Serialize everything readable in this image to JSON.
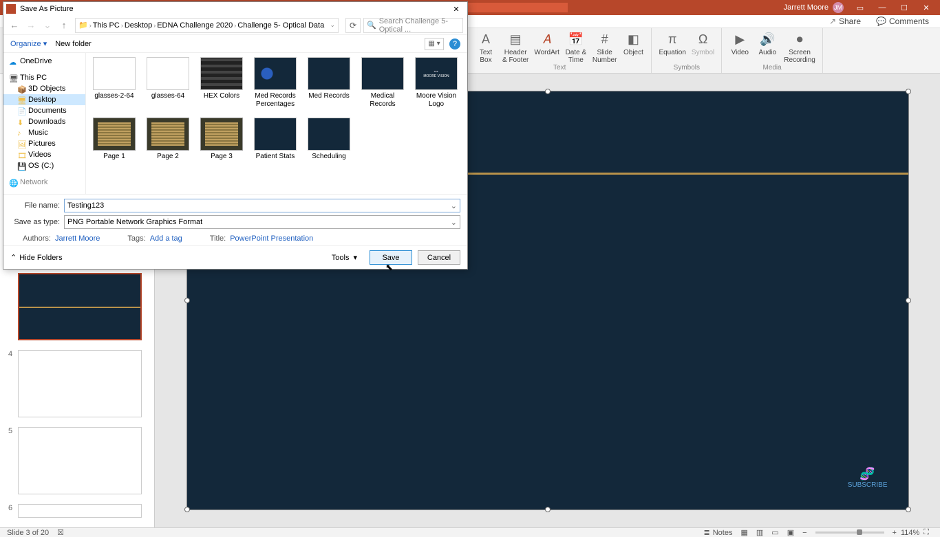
{
  "ppt": {
    "user": "Jarrett Moore",
    "initials": "JM",
    "share": "Share",
    "comments": "Comments",
    "ribbon": {
      "textGroup": "Text",
      "symbolsGroup": "Symbols",
      "mediaGroup": "Media",
      "textBox": "Text\nBox",
      "headerFooter": "Header\n& Footer",
      "wordArt": "WordArt",
      "dateTime": "Date &\nTime",
      "slideNumber": "Slide\nNumber",
      "object": "Object",
      "equation": "Equation",
      "symbol": "Symbol",
      "video": "Video",
      "audio": "Audio",
      "screenRec": "Screen\nRecording"
    },
    "status": {
      "slide": "Slide 3 of 20",
      "notes": "Notes",
      "zoom": "114%"
    },
    "thumbs": {
      "n4": "4",
      "n5": "5",
      "n6": "6"
    },
    "subscribe": "SUBSCRIBE"
  },
  "dialog": {
    "title": "Save As Picture",
    "breadcrumb": {
      "pc": "This PC",
      "desktop": "Desktop",
      "folder1": "EDNA Challenge 2020",
      "folder2": "Challenge 5- Optical Data"
    },
    "searchPlaceholder": "Search Challenge 5- Optical ...",
    "organize": "Organize",
    "newFolder": "New folder",
    "tree": {
      "onedrive": "OneDrive",
      "thispc": "This PC",
      "objects3d": "3D Objects",
      "desktop": "Desktop",
      "documents": "Documents",
      "downloads": "Downloads",
      "music": "Music",
      "pictures": "Pictures",
      "videos": "Videos",
      "osc": "OS (C:)",
      "network": "Network"
    },
    "files": [
      {
        "name": "glasses-2-64",
        "cls": ""
      },
      {
        "name": "glasses-64",
        "cls": ""
      },
      {
        "name": "HEX Colors",
        "cls": "stripes"
      },
      {
        "name": "Med Records Percentages",
        "cls": "rings"
      },
      {
        "name": "Med Records",
        "cls": "dark"
      },
      {
        "name": "Medical Records",
        "cls": "dark"
      },
      {
        "name": "Moore Vision Logo",
        "cls": "logo"
      },
      {
        "name": "Page 1",
        "cls": "tan"
      },
      {
        "name": "Page 2",
        "cls": "tan"
      },
      {
        "name": "Page 3",
        "cls": "tan"
      },
      {
        "name": "Patient Stats",
        "cls": "dark"
      },
      {
        "name": "Scheduling",
        "cls": "dark"
      }
    ],
    "fileNameLabel": "File name:",
    "fileName": "Testing123",
    "saveTypeLabel": "Save as type:",
    "saveType": "PNG Portable Network Graphics Format",
    "authorsLabel": "Authors:",
    "authors": "Jarrett Moore",
    "tagsLabel": "Tags:",
    "tags": "Add a tag",
    "titleLabel": "Title:",
    "titleVal": "PowerPoint Presentation",
    "hideFolders": "Hide Folders",
    "tools": "Tools",
    "save": "Save",
    "cancel": "Cancel"
  }
}
